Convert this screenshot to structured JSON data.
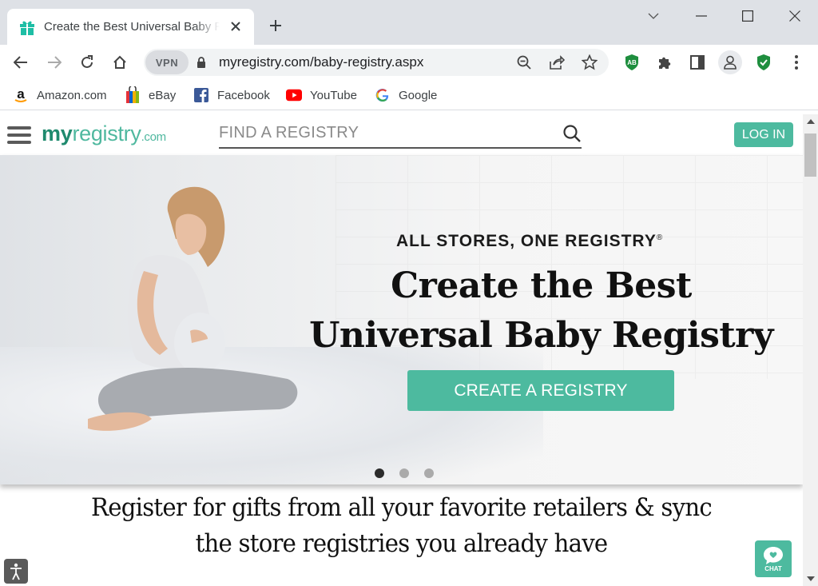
{
  "browser": {
    "tab": {
      "title": "Create the Best Universal Baby Registry | MyRegistry.com",
      "favicon": "gift-icon"
    },
    "new_tab": "plus-icon",
    "window_controls": [
      "chevron-down-icon",
      "minimize-icon",
      "maximize-icon",
      "close-icon"
    ],
    "nav": {
      "back": "back-arrow-icon",
      "forward": "forward-arrow-icon",
      "reload": "reload-icon",
      "home": "home-icon"
    },
    "omnibox": {
      "vpn_label": "VPN",
      "url": "myregistry.com/baby-registry.aspx",
      "icons": [
        "zoom-out-icon",
        "share-icon",
        "star-icon"
      ]
    },
    "extensions": [
      "adblock-icon",
      "puzzle-icon",
      "side-panel-icon",
      "profile-icon",
      "shield-check-icon",
      "menu-dots-icon"
    ],
    "bookmarks": [
      {
        "label": "Amazon.com",
        "icon": "amazon-icon"
      },
      {
        "label": "eBay",
        "icon": "ebay-icon"
      },
      {
        "label": "Facebook",
        "icon": "facebook-icon"
      },
      {
        "label": "YouTube",
        "icon": "youtube-icon"
      },
      {
        "label": "Google",
        "icon": "google-icon"
      }
    ]
  },
  "site": {
    "logo": {
      "my": "my",
      "registry": "registry",
      "com": ".com"
    },
    "search": {
      "placeholder": "FIND A REGISTRY",
      "value": ""
    },
    "login_label": "LOG IN",
    "hero": {
      "tagline": "ALL STORES, ONE REGISTRY",
      "tagline_mark": "®",
      "title_line1": "Create the Best",
      "title_line2": "Universal Baby Registry",
      "cta_label": "CREATE A REGISTRY",
      "carousel": {
        "slides": 3,
        "active": 1
      }
    },
    "subhead_line1": "Register for gifts from all your favorite retailers & sync",
    "subhead_line2": "the store registries you already have",
    "chat_label": "CHAT"
  },
  "colors": {
    "brand": "#4dba9f",
    "brand_dark": "#1f8a6e"
  }
}
